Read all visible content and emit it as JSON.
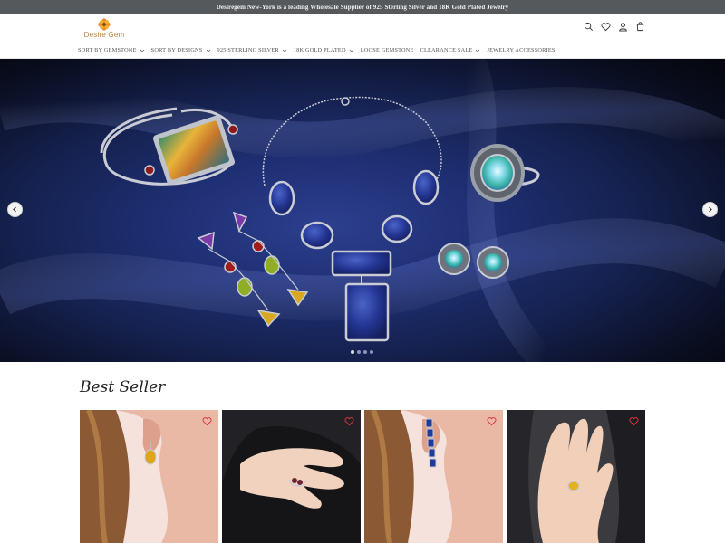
{
  "announcement": "Desiregem New-York is a leading Wholesale Supplier of 925 Sterling Silver and 18K Gold Plated Jewelry",
  "logo": {
    "text": "Desire Gem"
  },
  "header_icons": [
    "search-icon",
    "heart-icon",
    "account-icon",
    "cart-icon"
  ],
  "nav": {
    "items": [
      {
        "label": "SORT BY GEMSTONE",
        "has_dropdown": true
      },
      {
        "label": "SORT BY DESIGNS",
        "has_dropdown": true
      },
      {
        "label": "925 STERLING SILVER",
        "has_dropdown": true
      },
      {
        "label": "18K GOLD PLATED",
        "has_dropdown": true
      },
      {
        "label": "LOOSE GEMSTONE",
        "has_dropdown": false
      },
      {
        "label": "CLEARANCE SALE",
        "has_dropdown": true
      },
      {
        "label": "JEWELRY ACCESSORIES",
        "has_dropdown": false
      }
    ]
  },
  "hero": {
    "slide_count": 4,
    "active_slide": 1
  },
  "best_seller": {
    "title": "Best Seller"
  },
  "colors": {
    "announcement_bg": "#56595c",
    "hero_bg": "#1f2f74",
    "heart": "#d9343f",
    "logo": "#b58445"
  }
}
